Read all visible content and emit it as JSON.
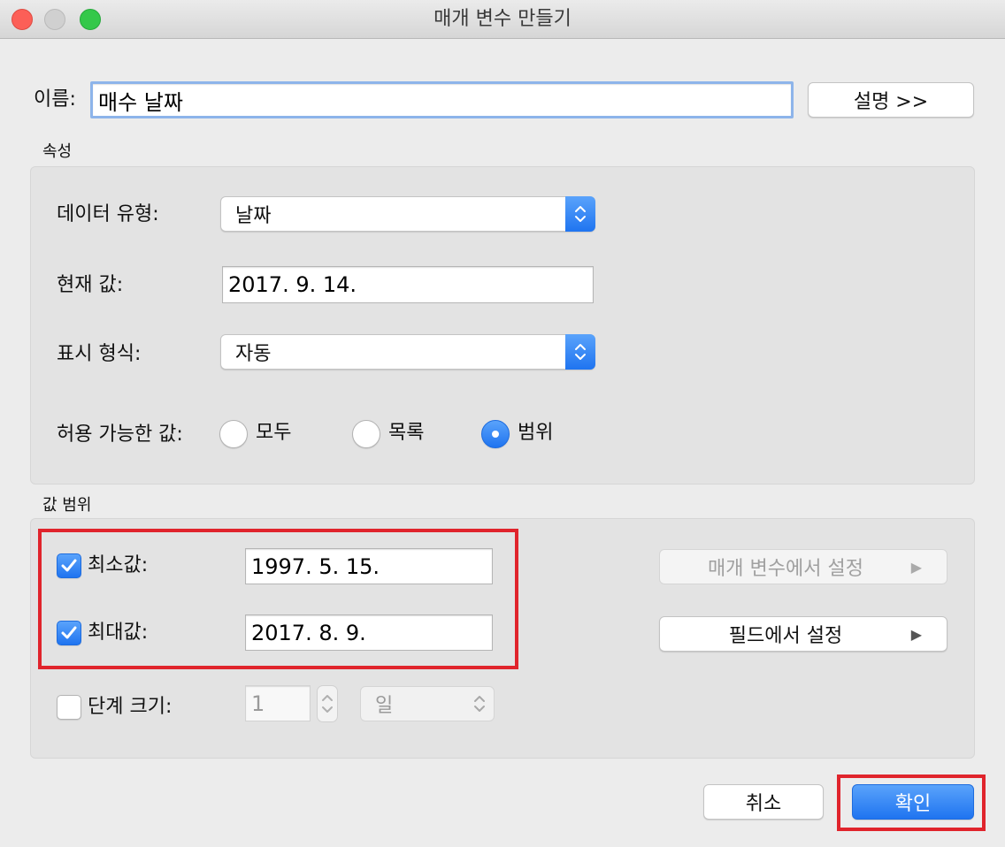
{
  "window": {
    "title": "매개 변수 만들기"
  },
  "name_row": {
    "label": "이름:",
    "value": "매수 날짜",
    "describe_button": "설명 >>"
  },
  "properties": {
    "section_label": "속성",
    "data_type": {
      "label": "데이터 유형:",
      "value": "날짜"
    },
    "current_value": {
      "label": "현재 값:",
      "value": "2017. 9. 14."
    },
    "display_format": {
      "label": "표시 형식:",
      "value": "자동"
    },
    "allowable_values": {
      "label": "허용 가능한 값:",
      "options": [
        "모두",
        "목록",
        "범위"
      ],
      "selected": "범위"
    }
  },
  "range": {
    "section_label": "값 범위",
    "minimum": {
      "label": "최소값:",
      "value": "1997. 5. 15.",
      "checked": true
    },
    "maximum": {
      "label": "최대값:",
      "value": "2017. 8. 9.",
      "checked": true
    },
    "step_size": {
      "label": "단계 크기:",
      "value": "1",
      "unit": "일",
      "checked": false
    },
    "set_from_parameter": "매개 변수에서 설정",
    "set_from_field": "필드에서 설정"
  },
  "footer": {
    "cancel": "취소",
    "ok": "확인"
  },
  "colors": {
    "accent": "#1f74f0",
    "highlight": "#e0242c"
  }
}
